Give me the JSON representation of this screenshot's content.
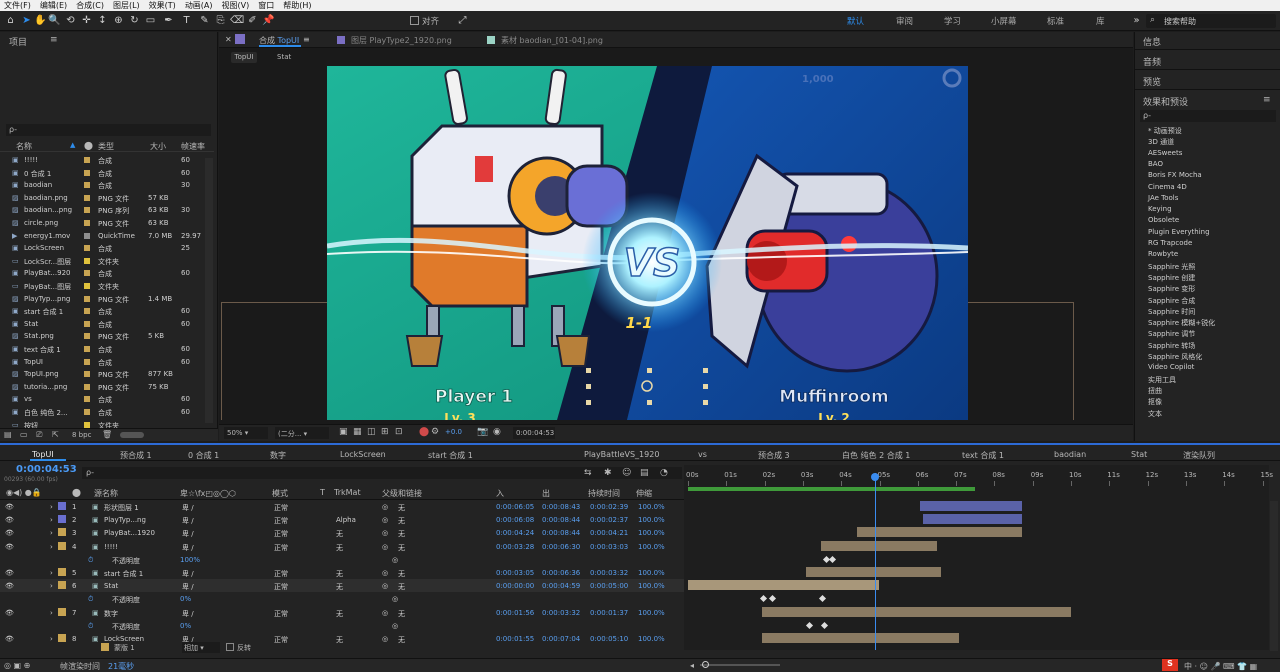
{
  "menu": [
    "文件(F)",
    "编辑(E)",
    "合成(C)",
    "图层(L)",
    "效果(T)",
    "动画(A)",
    "视图(V)",
    "窗口",
    "帮助(H)"
  ],
  "toolbar": {
    "snap_label": "对齐",
    "workspaces": [
      "默认",
      "审阅",
      "学习",
      "小屏幕",
      "标准",
      "库"
    ],
    "search_placeholder": "搜索帮助"
  },
  "project": {
    "title": "项目",
    "search": "ρ-",
    "headers": [
      "名称",
      "类型",
      "大小",
      "帧速率"
    ],
    "items": [
      {
        "name": "!!!!!",
        "type": "合成",
        "size": "",
        "fps": "60",
        "color": "#c8a452"
      },
      {
        "name": "0 合成 1",
        "type": "合成",
        "size": "",
        "fps": "60",
        "color": "#c8a452"
      },
      {
        "name": "baodian",
        "type": "合成",
        "size": "",
        "fps": "30",
        "color": "#c8a452"
      },
      {
        "name": "baodian.png",
        "type": "PNG 文件",
        "size": "57 KB",
        "fps": "",
        "color": "#c8a452"
      },
      {
        "name": "baodian...png",
        "type": "PNG 序列",
        "size": "63 KB",
        "fps": "30",
        "color": "#c8a452"
      },
      {
        "name": "circle.png",
        "type": "PNG 文件",
        "size": "63 KB",
        "fps": "",
        "color": "#c8a452"
      },
      {
        "name": "energy1.mov",
        "type": "QuickTime",
        "size": "7.0 MB",
        "fps": "29.97",
        "color": "#8f8f8f"
      },
      {
        "name": "LockScreen",
        "type": "合成",
        "size": "",
        "fps": "25",
        "color": "#c8a452"
      },
      {
        "name": "LockScr...图层",
        "type": "文件夹",
        "size": "",
        "fps": "",
        "color": "#e0c23c"
      },
      {
        "name": "PlayBat...920",
        "type": "合成",
        "size": "",
        "fps": "60",
        "color": "#c8a452"
      },
      {
        "name": "PlayBat...图层",
        "type": "文件夹",
        "size": "",
        "fps": "",
        "color": "#e0c23c"
      },
      {
        "name": "PlayTyp...png",
        "type": "PNG 文件",
        "size": "1.4 MB",
        "fps": "",
        "color": "#c8a452"
      },
      {
        "name": "start 合成 1",
        "type": "合成",
        "size": "",
        "fps": "60",
        "color": "#c8a452"
      },
      {
        "name": "Stat",
        "type": "合成",
        "size": "",
        "fps": "60",
        "color": "#c8a452"
      },
      {
        "name": "Stat.png",
        "type": "PNG 文件",
        "size": "5 KB",
        "fps": "",
        "color": "#c8a452"
      },
      {
        "name": "text 合成 1",
        "type": "合成",
        "size": "",
        "fps": "60",
        "color": "#c8a452"
      },
      {
        "name": "TopUI",
        "type": "合成",
        "size": "",
        "fps": "60",
        "color": "#c8a452"
      },
      {
        "name": "TopUI.png",
        "type": "PNG 文件",
        "size": "877 KB",
        "fps": "",
        "color": "#c8a452"
      },
      {
        "name": "tutoria...png",
        "type": "PNG 文件",
        "size": "75 KB",
        "fps": "",
        "color": "#c8a452"
      },
      {
        "name": "vs",
        "type": "合成",
        "size": "",
        "fps": "60",
        "color": "#c8a452"
      },
      {
        "name": "白色 纯色 2...",
        "type": "合成",
        "size": "",
        "fps": "60",
        "color": "#c8a452"
      },
      {
        "name": "按钮",
        "type": "文件夹",
        "size": "",
        "fps": "",
        "color": "#e0c23c"
      }
    ],
    "bpc": "8 bpc"
  },
  "viewer": {
    "tabs": [
      {
        "prefix": "合成",
        "name": "TopUI"
      },
      {
        "prefix": "图层",
        "name": "PlayType2_1920.png"
      },
      {
        "prefix": "素材",
        "name": "baodian_[01-04].png"
      }
    ],
    "subtabs": [
      "TopUI",
      "Stat"
    ],
    "game": {
      "player1": "Player 1",
      "p1_level": "Lv. 3",
      "player2": "Muffinroom",
      "p2_level": "Lv. 2",
      "score": "1-1",
      "vs": "VS",
      "coins": "1,000"
    },
    "zoom": "50%",
    "resolution": "(二分...",
    "exposure": "+0.0",
    "timecode": "0:00:04:53"
  },
  "right_panel": {
    "items": [
      "信息",
      "音频",
      "预览"
    ],
    "effects_title": "效果和预设",
    "search": "ρ-",
    "effects": [
      "* 动画预设",
      "3D 通道",
      "AESweets",
      "BAO",
      "Boris FX Mocha",
      "Cinema 4D",
      "JAe Tools",
      "Keying",
      "Obsolete",
      "Plugin Everything",
      "RG Trapcode",
      "Rowbyte",
      "Sapphire 光照",
      "Sapphire 创建",
      "Sapphire 变形",
      "Sapphire 合成",
      "Sapphire 时间",
      "Sapphire 模糊+锐化",
      "Sapphire 调节",
      "Sapphire 转场",
      "Sapphire 风格化",
      "Video Copilot",
      "实用工具",
      "扭曲",
      "抠像",
      "文本"
    ]
  },
  "timeline": {
    "tabs": [
      "TopUI",
      "预合成 1",
      "0 合成 1",
      "数字",
      "LockScreen",
      "start 合成 1",
      "PlayBattleVS_1920",
      "vs",
      "预合成 3",
      "白色 纯色 2 合成 1",
      "text 合成 1",
      "baodian",
      "Stat",
      "渲染队列"
    ],
    "timecode": "0:00:04:53",
    "frames": "00293 (60.00 fps)",
    "search": "ρ-",
    "headers": {
      "name": "源名称",
      "mode": "模式",
      "t": "T",
      "trkmat": "TrkMat",
      "parent": "父级和链接",
      "in": "入",
      "out": "出",
      "duration": "持续时间",
      "stretch": "伸缩"
    },
    "ruler": [
      "00s",
      "01s",
      "02s",
      "03s",
      "04s",
      "05s",
      "06s",
      "07s",
      "08s",
      "09s",
      "10s",
      "11s",
      "12s",
      "13s",
      "14s",
      "15s"
    ],
    "layers": [
      {
        "num": "1",
        "name": "形状图层 1",
        "mode": "正常",
        "trk": "",
        "parent": "无",
        "in": "0:00:06:05",
        "out": "0:00:08:43",
        "dur": "0:00:02:39",
        "st": "100.0%",
        "color": "#6a6fd0",
        "bar": [
          6.05,
          8.72
        ],
        "barcolor": "#5a62a8"
      },
      {
        "num": "2",
        "name": "PlayTyp...ng",
        "mode": "正常",
        "trk": "Alpha",
        "parent": "无",
        "in": "0:00:06:08",
        "out": "0:00:08:44",
        "dur": "0:00:02:37",
        "st": "100.0%",
        "color": "#6a6fd0",
        "bar": [
          6.13,
          8.73
        ],
        "barcolor": "#5a62a8"
      },
      {
        "num": "3",
        "name": "PlayBat...1920",
        "mode": "正常",
        "trk": "无",
        "parent": "无",
        "in": "0:00:04:24",
        "out": "0:00:08:44",
        "dur": "0:00:04:21",
        "st": "100.0%",
        "color": "#c8a452",
        "bar": [
          4.4,
          8.73
        ],
        "barcolor": "#8a7a62"
      },
      {
        "num": "4",
        "name": "!!!!!",
        "mode": "正常",
        "trk": "无",
        "parent": "无",
        "in": "0:00:03:28",
        "out": "0:00:06:30",
        "dur": "0:00:03:03",
        "st": "100.0%",
        "color": "#c8a452",
        "bar": [
          3.47,
          6.5
        ],
        "barcolor": "#8a7a62"
      },
      {
        "sub": "不透明度",
        "value": "100%",
        "keys": [
          3.55,
          3.7
        ]
      },
      {
        "num": "5",
        "name": "start 合成 1",
        "mode": "正常",
        "trk": "无",
        "parent": "无",
        "in": "0:00:03:05",
        "out": "0:00:06:36",
        "dur": "0:00:03:32",
        "st": "100.0%",
        "color": "#c8a452",
        "bar": [
          3.08,
          6.6
        ],
        "barcolor": "#8a7a62"
      },
      {
        "num": "6",
        "name": "Stat",
        "mode": "正常",
        "trk": "无",
        "parent": "无",
        "in": "0:00:00:00",
        "out": "0:00:04:59",
        "dur": "0:00:05:00",
        "st": "100.0%",
        "color": "#c8a452",
        "bar": [
          0,
          4.98
        ],
        "barcolor": "#a8977a"
      },
      {
        "sub": "不透明度",
        "value": "0%",
        "keys": [
          1.9,
          2.15,
          3.45
        ]
      },
      {
        "num": "7",
        "name": "数字",
        "mode": "正常",
        "trk": "无",
        "parent": "无",
        "in": "0:00:01:56",
        "out": "0:00:03:32",
        "dur": "0:00:01:37",
        "st": "100.0%",
        "color": "#c8a452",
        "bar": [
          1.93,
          10.0
        ],
        "barcolor": "#8a7a62"
      },
      {
        "sub": "不透明度",
        "value": "0%",
        "keys": [
          3.1,
          3.5
        ]
      },
      {
        "num": "8",
        "name": "LockScreen",
        "mode": "正常",
        "trk": "无",
        "parent": "无",
        "in": "0:00:01:55",
        "out": "0:00:07:04",
        "dur": "0:00:05:10",
        "st": "100.0%",
        "color": "#c8a452",
        "bar": [
          1.92,
          7.07
        ],
        "barcolor": "#8a7a62"
      }
    ],
    "bottom_row": {
      "label": "蒙版 1",
      "mode": "相加",
      "invert": "反转"
    },
    "footer": {
      "label": "帧渲染时间",
      "value": "21毫秒"
    },
    "current_time": 4.88,
    "work_area": [
      0,
      7.5
    ]
  }
}
